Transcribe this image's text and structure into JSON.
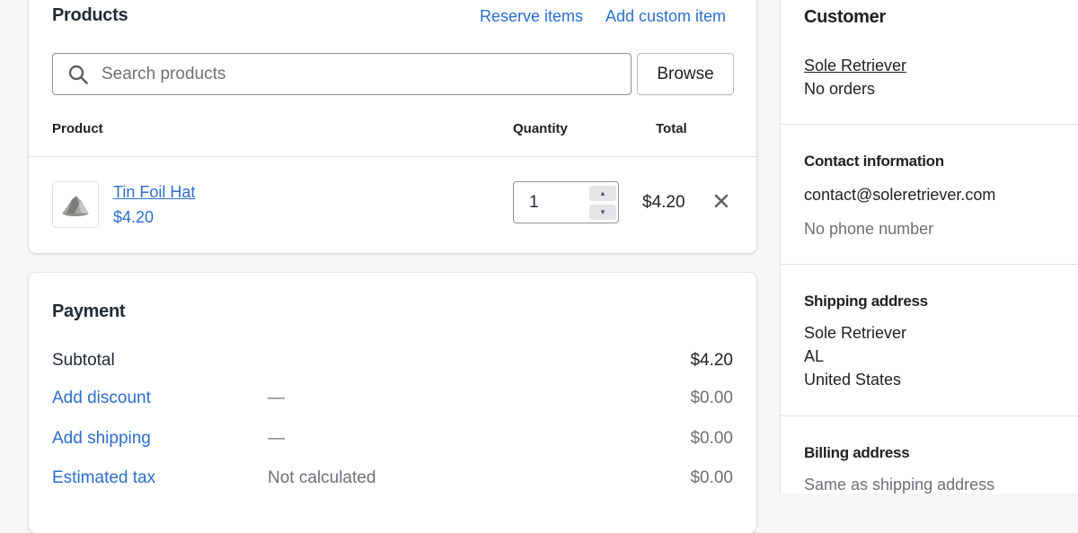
{
  "products": {
    "title": "Products",
    "reserve_items": "Reserve items",
    "add_custom_item": "Add custom item",
    "search": {
      "placeholder": "Search products",
      "value": ""
    },
    "browse_label": "Browse",
    "columns": {
      "product": "Product",
      "quantity": "Quantity",
      "total": "Total"
    },
    "items": [
      {
        "name": "Tin Foil Hat",
        "price": "$4.20",
        "quantity": "1",
        "total": "$4.20"
      }
    ]
  },
  "payment": {
    "title": "Payment",
    "subtotal": {
      "label": "Subtotal",
      "amount": "$4.20"
    },
    "discount": {
      "label": "Add discount",
      "detail": "—",
      "amount": "$0.00"
    },
    "shipping": {
      "label": "Add shipping",
      "detail": "—",
      "amount": "$0.00"
    },
    "tax": {
      "label": "Estimated tax",
      "detail": "Not calculated",
      "amount": "$0.00"
    }
  },
  "customer": {
    "title": "Customer",
    "name": "Sole Retriever",
    "orders": "No orders",
    "contact": {
      "title": "Contact information",
      "email": "contact@soleretriever.com",
      "phone": "No phone number"
    },
    "shipping_address": {
      "title": "Shipping address",
      "lines": [
        "Sole Retriever",
        "AL",
        "United States"
      ]
    },
    "billing_address": {
      "title": "Billing address",
      "value": "Same as shipping address"
    }
  },
  "colors": {
    "link": "#2c6ecb",
    "text": "#202223",
    "muted": "#6d7175",
    "background": "#f4f6f8"
  },
  "icons": [
    "search-icon",
    "close-icon",
    "stepper-up-icon",
    "stepper-down-icon"
  ]
}
